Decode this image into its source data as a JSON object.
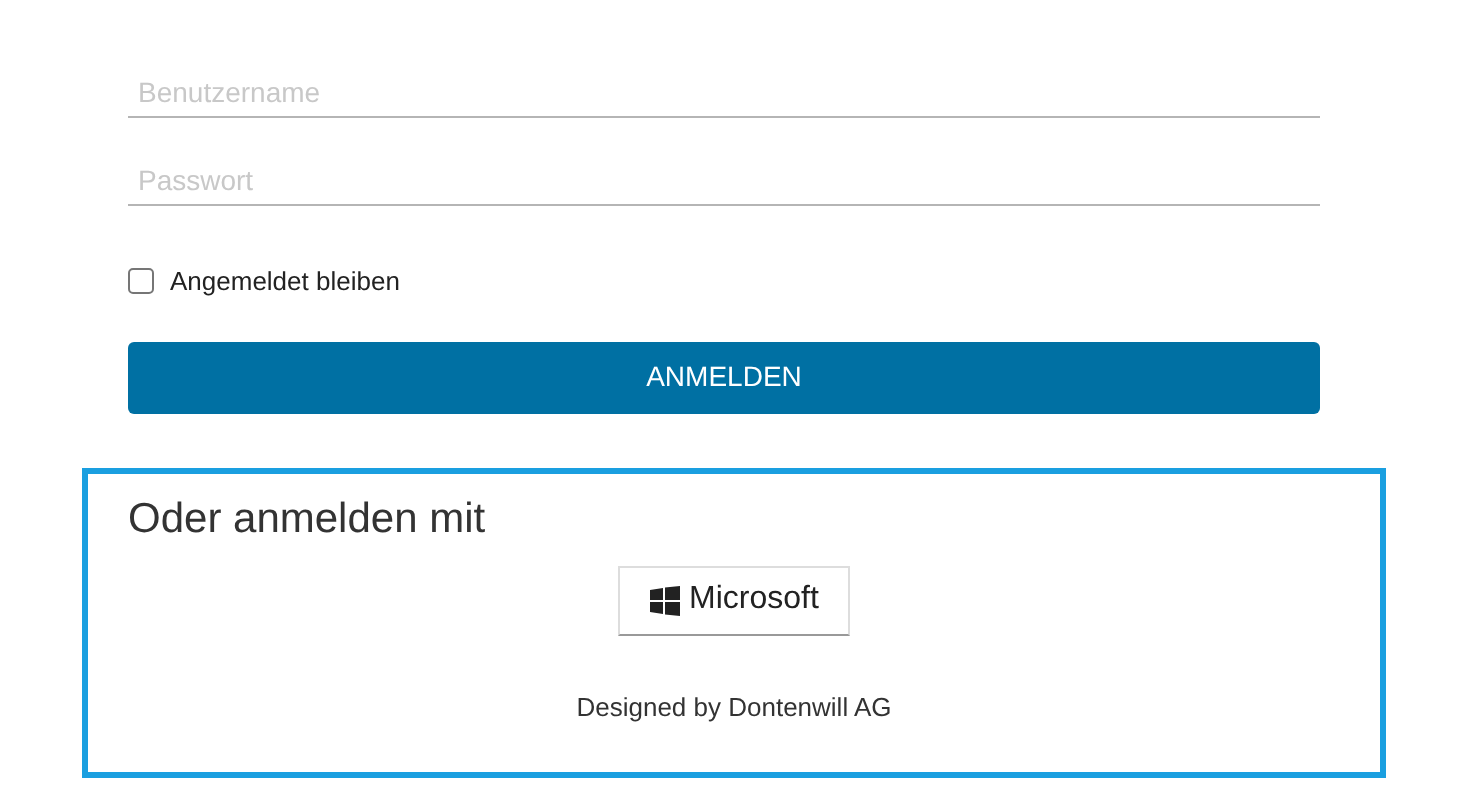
{
  "fields": [
    {
      "placeholder": "Benutzername"
    },
    {
      "placeholder": "Passwort"
    }
  ],
  "remember": {
    "label": "Angemeldet bleiben",
    "checked": false
  },
  "submit_button": "ANMELDEN",
  "external_login": {
    "heading": "Oder anmelden mit",
    "providers": [
      {
        "label": "Microsoft"
      }
    ],
    "footer": "Designed by Dontenwill AG"
  }
}
